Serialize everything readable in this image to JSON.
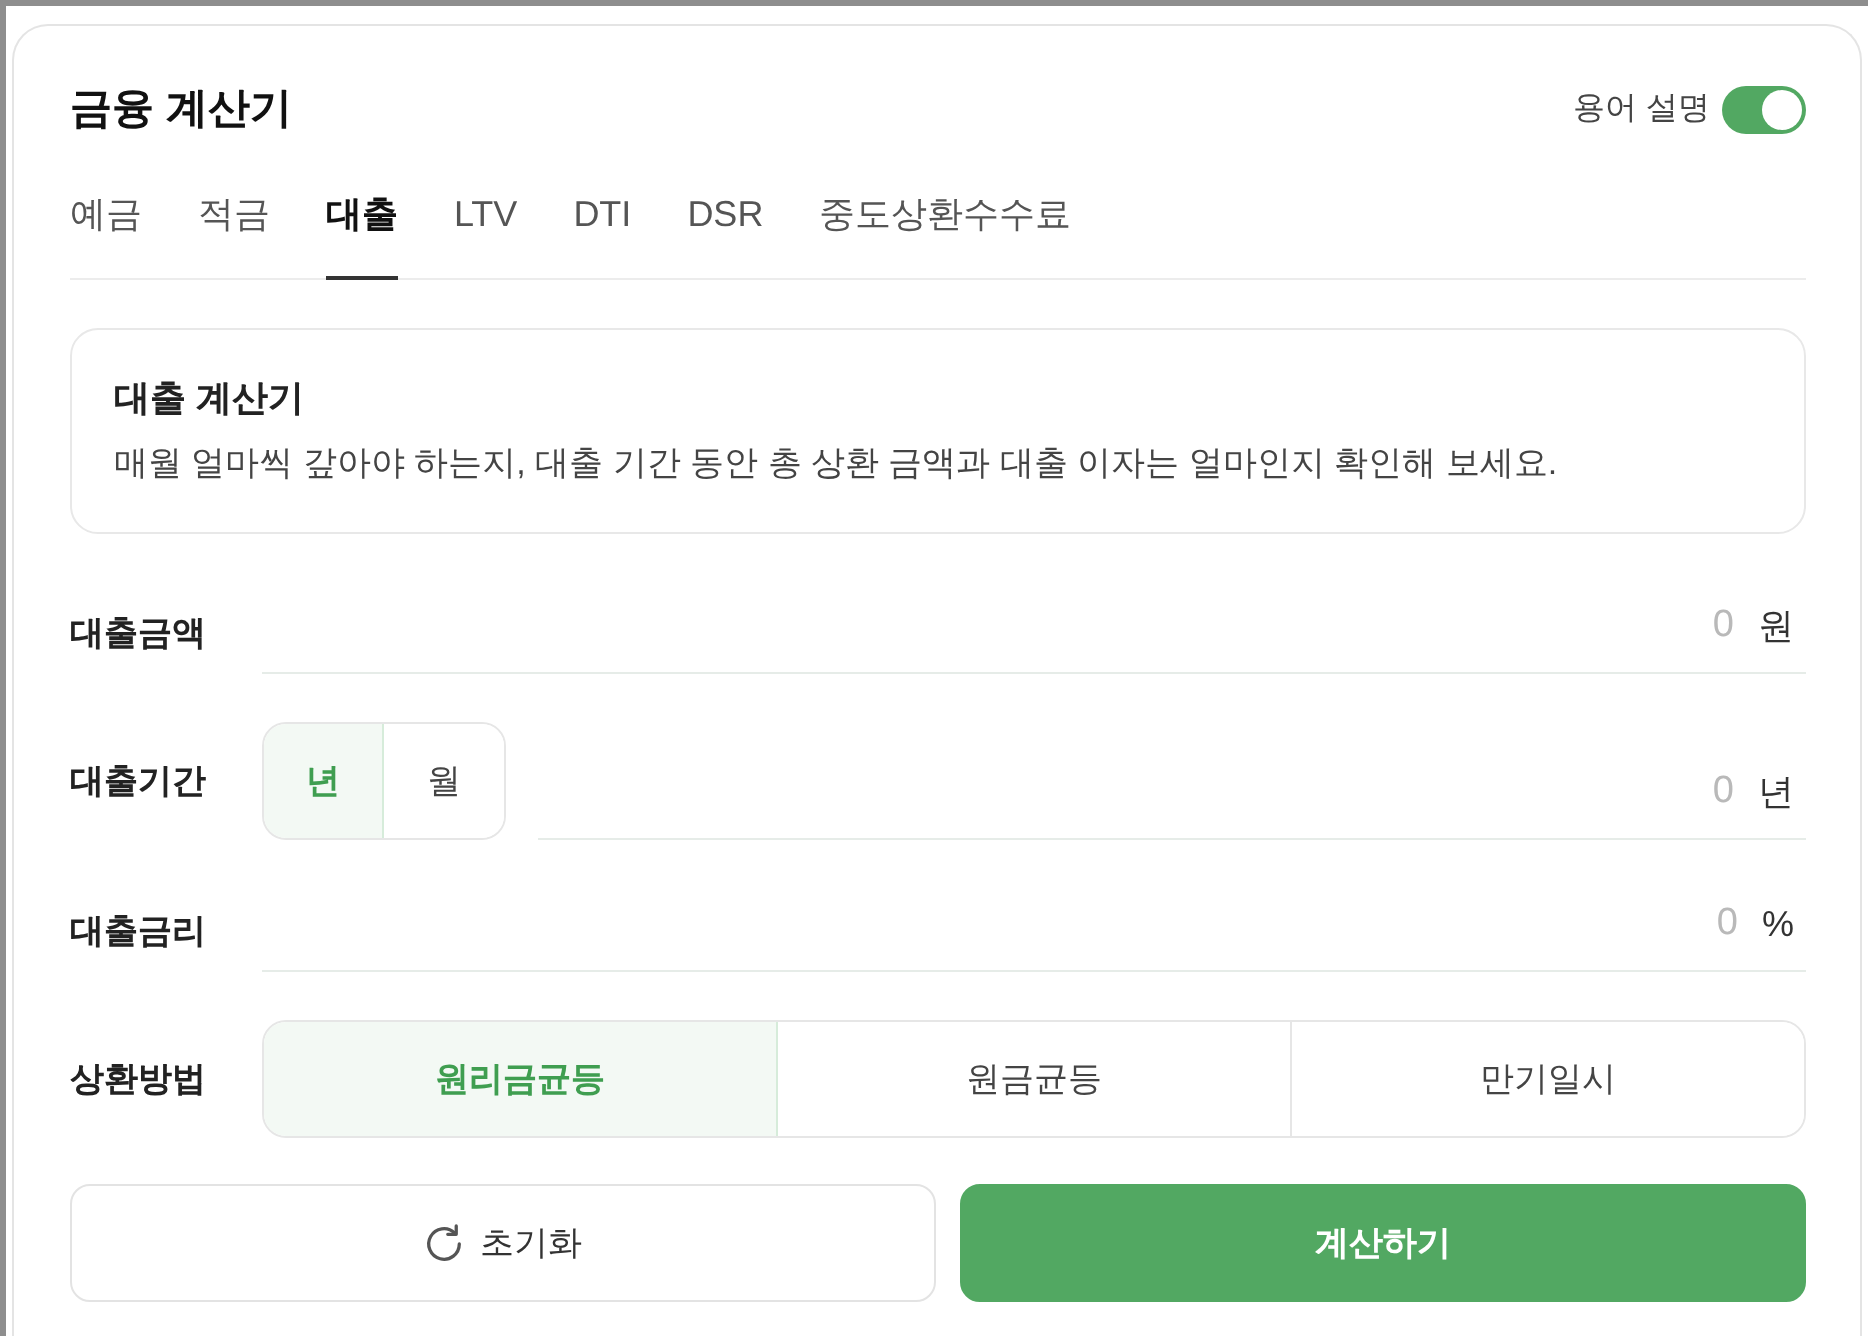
{
  "header": {
    "title": "금융 계산기",
    "term_toggle": {
      "label": "용어 설명",
      "on": true
    }
  },
  "tabs": [
    {
      "label": "예금",
      "selected": false
    },
    {
      "label": "적금",
      "selected": false
    },
    {
      "label": "대출",
      "selected": true
    },
    {
      "label": "LTV",
      "selected": false
    },
    {
      "label": "DTI",
      "selected": false
    },
    {
      "label": "DSR",
      "selected": false
    },
    {
      "label": "중도상환수수료",
      "selected": false
    }
  ],
  "info_card": {
    "title": "대출 계산기",
    "description": "매월 얼마씩 갚아야 하는지, 대출 기간 동안 총 상환 금액과 대출 이자는 얼마인지 확인해 보세요."
  },
  "fields": [
    {
      "kind": "input",
      "label": "대출금액",
      "placeholder": "0",
      "unit": "원"
    },
    {
      "kind": "period",
      "label": "대출기간",
      "options": [
        {
          "label": "년",
          "selected": true
        },
        {
          "label": "월",
          "selected": false
        }
      ],
      "placeholder": "0",
      "unit": "년"
    },
    {
      "kind": "input",
      "label": "대출금리",
      "placeholder": "0",
      "unit": "%"
    },
    {
      "kind": "choice",
      "label": "상환방법",
      "options": [
        {
          "label": "원리금균등",
          "selected": true
        },
        {
          "label": "원금균등",
          "selected": false
        },
        {
          "label": "만기일시",
          "selected": false
        }
      ]
    }
  ],
  "buttons": [
    {
      "kind": "reset",
      "label": "초기화"
    },
    {
      "kind": "submit",
      "label": "계산하기"
    }
  ]
}
